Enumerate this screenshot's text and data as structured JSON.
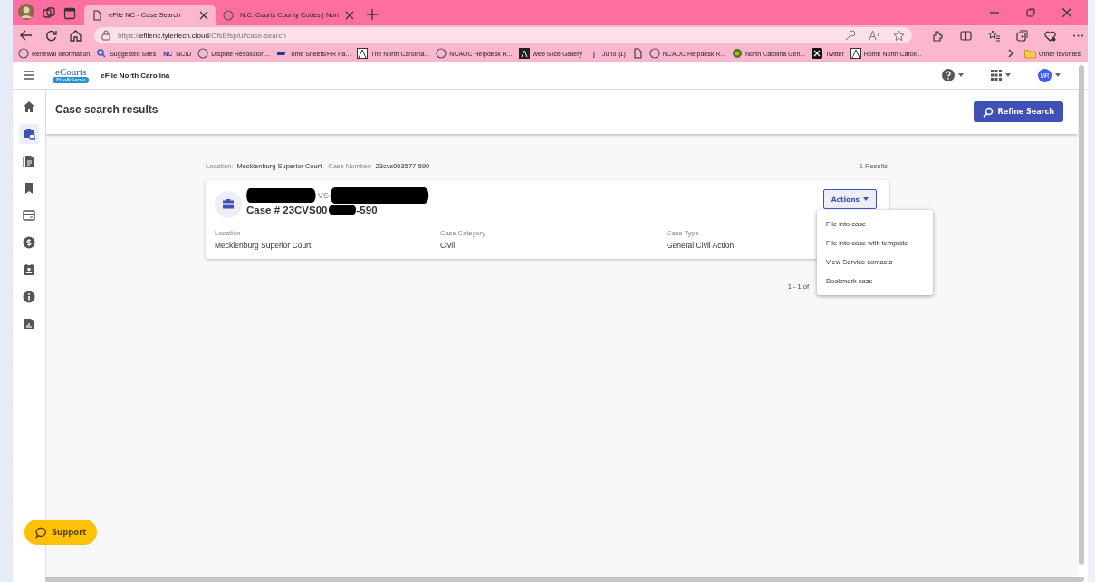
{
  "browser": {
    "tabs": [
      {
        "title": "eFile NC - Case Search",
        "selected": true
      },
      {
        "title": "N.C. Courts County Codes | Nort",
        "selected": false
      }
    ],
    "url": {
      "scheme": "https://",
      "host": "efilenc.tylertech.cloud",
      "path": "/OfsEfsp/ui/case-search"
    },
    "bookmarks": [
      {
        "label": "Renewal Information"
      },
      {
        "label": "Suggested Sites"
      },
      {
        "label": "NCID",
        "icon_text": "NC"
      },
      {
        "label": "Dispute Resolution..."
      },
      {
        "label": "Time Sheets/HR Pa..."
      },
      {
        "label": "The North Carolina..."
      },
      {
        "label": "NCAOC Helpdesk R..."
      },
      {
        "label": "Web Slice Gallery"
      },
      {
        "label": "Juno (1)",
        "icon_text": "j"
      },
      {
        "label": "NCAOC Helpdesk R..."
      },
      {
        "label": "North Carolina Gen..."
      },
      {
        "label": "Twitter"
      },
      {
        "label": "Home North Caroli..."
      }
    ],
    "other_favorites": "Other favorites"
  },
  "app": {
    "logo": {
      "top": "eCourts",
      "bottom": "File&Serve"
    },
    "title": "eFile North Carolina",
    "avatar": "MR",
    "sidebar": [
      {
        "selected": false
      },
      {
        "selected": true
      },
      {
        "selected": false
      },
      {
        "selected": false
      },
      {
        "selected": false
      },
      {
        "selected": false
      },
      {
        "selected": false
      },
      {
        "selected": false
      },
      {
        "selected": false
      }
    ],
    "page_title": "Case search results",
    "refine_button": "Refine Search",
    "criteria": [
      {
        "label": "Location:",
        "value": "Mecklenburg Superior Court"
      },
      {
        "label": "Case Number:",
        "value": "23cvs003577-590"
      }
    ],
    "results_count": "1 Results",
    "case": {
      "versus": "VS",
      "number_start": "Case # 23CVS00",
      "number_end": "-590",
      "fields": [
        {
          "label": "Location",
          "value": "Mecklenburg Superior Court"
        },
        {
          "label": "Case Category",
          "value": "Civil"
        },
        {
          "label": "Case Type",
          "value": "General Civil Action"
        }
      ],
      "actions_button": "Actions",
      "menu": [
        "File into case",
        "File into case with template",
        "View Service contacts",
        "Bookmark case"
      ]
    },
    "pagination": "1 - 1 of",
    "support_button": "Support"
  }
}
